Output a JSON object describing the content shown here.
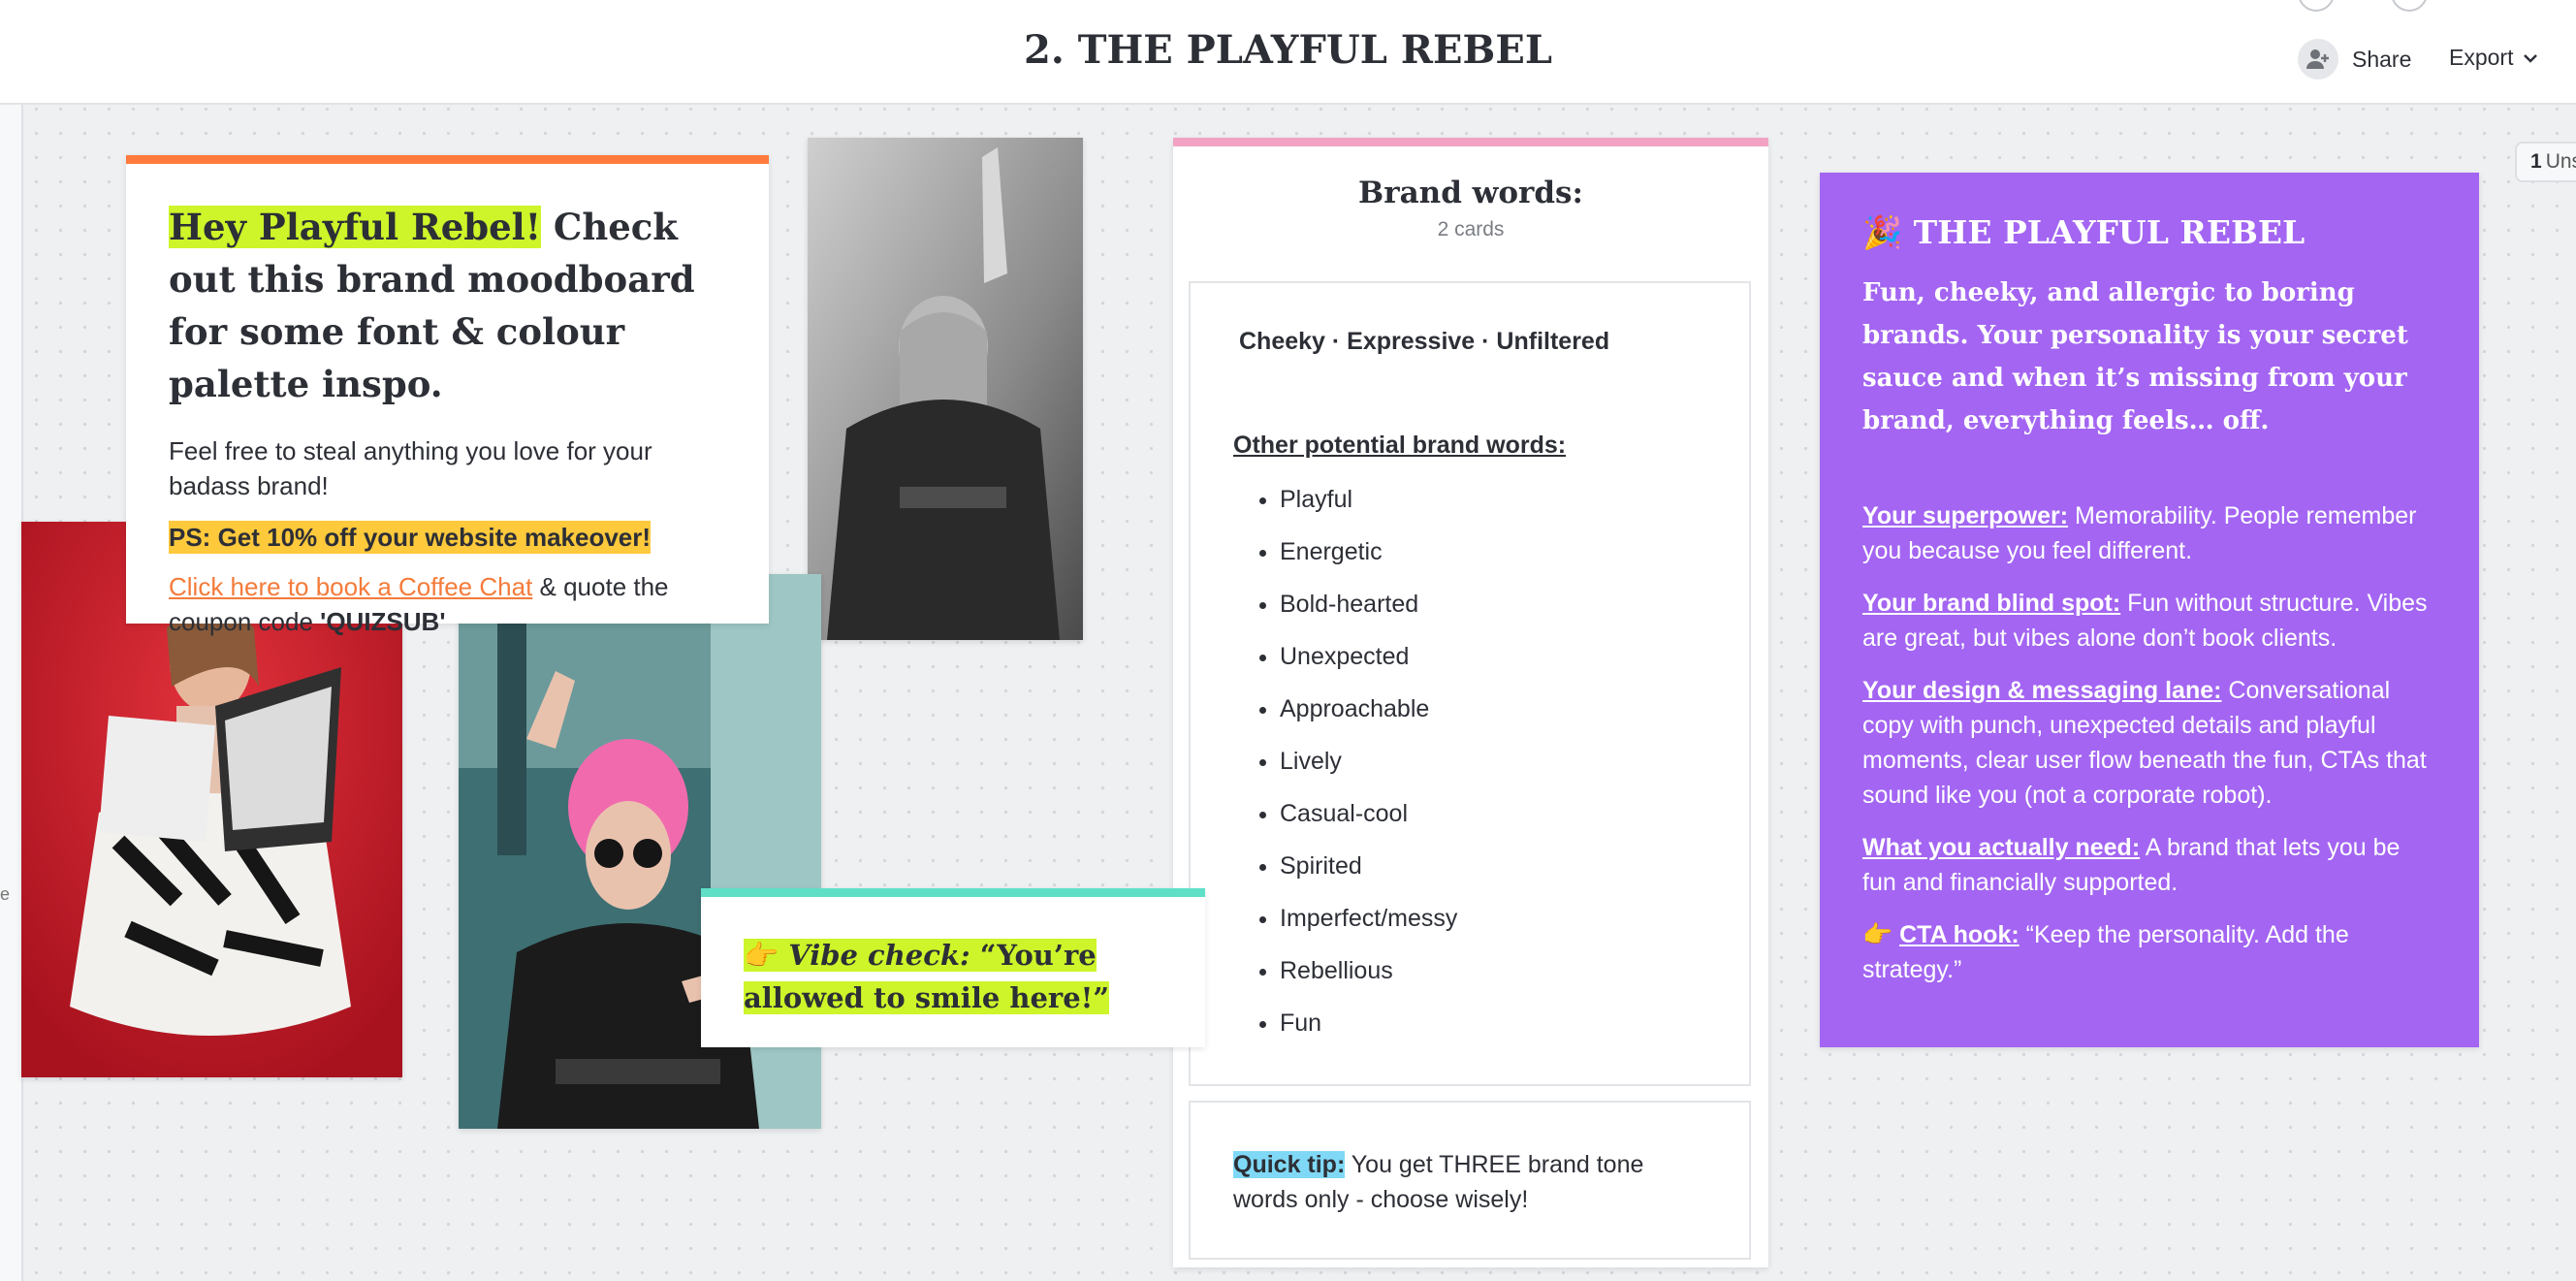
{
  "header": {
    "title": "2. THE PLAYFUL REBEL",
    "share_label": "Share",
    "export_label": "Export"
  },
  "sidebar_right": {
    "unsorted_count": "1",
    "unsorted_label": "Uns"
  },
  "intro_card": {
    "headline_highlight": "Hey Playful Rebel!",
    "headline_rest": " Check out this brand moodboard for some font & colour palette inspo.",
    "body": "Feel free to steal anything you love for your badass brand!",
    "ps": "PS: Get 10% off your website makeover!",
    "link_text": "Click here to book a Coffee Chat",
    "after_link": " & quote the coupon code ",
    "coupon": "'QUIZSUB'"
  },
  "vibe_card": {
    "emoji": "👉",
    "label": "Vibe check:",
    "quote": " “You’re allowed to smile here!”"
  },
  "brand_words": {
    "title": "Brand words:",
    "count": "2 cards",
    "main_words": "Cheeky · Expressive · Unfiltered",
    "other_label": "Other potential brand words:",
    "list": [
      "Playful",
      "Energetic",
      "Bold-hearted",
      "Unexpected",
      "Approachable",
      "Lively",
      "Casual-cool",
      "Spirited",
      "Imperfect/messy",
      "Rebellious",
      "Fun"
    ],
    "tip_label": "Quick tip:",
    "tip_text": " You get THREE brand tone words only - choose wisely!"
  },
  "rebel_card": {
    "emoji": "🎉",
    "title": "THE PLAYFUL REBEL",
    "lead": "Fun, cheeky, and allergic to boring brands. Your personality is your secret sauce and when it’s missing from your brand, everything feels… off.",
    "sections": [
      {
        "label": "Your superpower:",
        "text": " Memorability. People remember you because you feel different."
      },
      {
        "label": "Your brand blind spot:",
        "text": " Fun without structure. Vibes are great, but vibes alone don’t book clients."
      },
      {
        "label": "Your design & messaging lane:",
        "text": " Conversational copy with punch, unexpected details and playful moments, clear user flow beneath the fun, CTAs that sound like you (not a corporate robot)."
      },
      {
        "label": "What you actually need:",
        "text": " A brand that lets you be fun and financially supported."
      },
      {
        "emoji": "👉",
        "label": "CTA hook:",
        "text": " “Keep the personality. Add the strategy.”"
      }
    ]
  },
  "rail_glyph": "e",
  "colors": {
    "accent_orange": "#ff7a3d",
    "lime": "#cdf52a",
    "purple": "#a365f2",
    "pink": "#f2a3c4",
    "teal": "#5fe0c6",
    "cyan": "#7fd9f6",
    "yellow": "#ffc93c"
  }
}
